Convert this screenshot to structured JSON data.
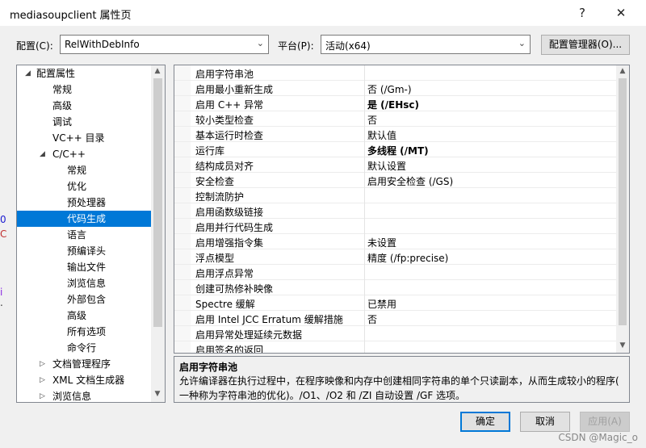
{
  "window": {
    "title": "mediasoupclient 属性页",
    "help": "?",
    "close": "✕"
  },
  "config_bar": {
    "config_label": "配置(C):",
    "config_value": "RelWithDebInfo",
    "platform_label": "平台(P):",
    "platform_value": "活动(x64)",
    "manager_button": "配置管理器(O)..."
  },
  "tree": {
    "items": [
      {
        "label": "配置属性"
      },
      {
        "label": "常规"
      },
      {
        "label": "高级"
      },
      {
        "label": "调试"
      },
      {
        "label": "VC++ 目录"
      },
      {
        "label": "C/C++"
      },
      {
        "label": "常规"
      },
      {
        "label": "优化"
      },
      {
        "label": "预处理器"
      },
      {
        "label": "代码生成"
      },
      {
        "label": "语言"
      },
      {
        "label": "预编译头"
      },
      {
        "label": "输出文件"
      },
      {
        "label": "浏览信息"
      },
      {
        "label": "外部包含"
      },
      {
        "label": "高级"
      },
      {
        "label": "所有选项"
      },
      {
        "label": "命令行"
      },
      {
        "label": "文档管理程序"
      },
      {
        "label": "XML 文档生成器"
      },
      {
        "label": "浏览信息"
      }
    ]
  },
  "properties": [
    {
      "name": "启用字符串池",
      "value": ""
    },
    {
      "name": "启用最小重新生成",
      "value": "否 (/Gm-)"
    },
    {
      "name": "启用 C++ 异常",
      "value": "是 (/EHsc)"
    },
    {
      "name": "较小类型检查",
      "value": "否"
    },
    {
      "name": "基本运行时检查",
      "value": "默认值"
    },
    {
      "name": "运行库",
      "value": "多线程 (/MT)"
    },
    {
      "name": "结构成员对齐",
      "value": "默认设置"
    },
    {
      "name": "安全检查",
      "value": "启用安全检查 (/GS)"
    },
    {
      "name": "控制流防护",
      "value": ""
    },
    {
      "name": "启用函数级链接",
      "value": ""
    },
    {
      "name": "启用并行代码生成",
      "value": ""
    },
    {
      "name": "启用增强指令集",
      "value": "未设置"
    },
    {
      "name": "浮点模型",
      "value": "精度 (/fp:precise)"
    },
    {
      "name": "启用浮点异常",
      "value": ""
    },
    {
      "name": "创建可热修补映像",
      "value": ""
    },
    {
      "name": "Spectre 缓解",
      "value": "已禁用"
    },
    {
      "name": "启用 Intel JCC Erratum 缓解措施",
      "value": "否"
    },
    {
      "name": "启用异常处理延续元数据",
      "value": ""
    },
    {
      "name": "启用签名的返回",
      "value": ""
    }
  ],
  "description": {
    "title": "启用字符串池",
    "line1": "允许编译器在执行过程中，在程序映像和内存中创建相同字符串的单个只读副本，从而生成较小的程序(",
    "line2": "一种称为字符串池的优化)。/O1、/O2 和 /ZI 自动设置 /GF 选项。"
  },
  "buttons": {
    "ok": "确定",
    "cancel": "取消",
    "apply": "应用(A)"
  },
  "background": {
    "watermark": "CSDN @Magic_o"
  },
  "colors": {
    "selection": "#0078d7",
    "primary_border": "#0078d7"
  }
}
